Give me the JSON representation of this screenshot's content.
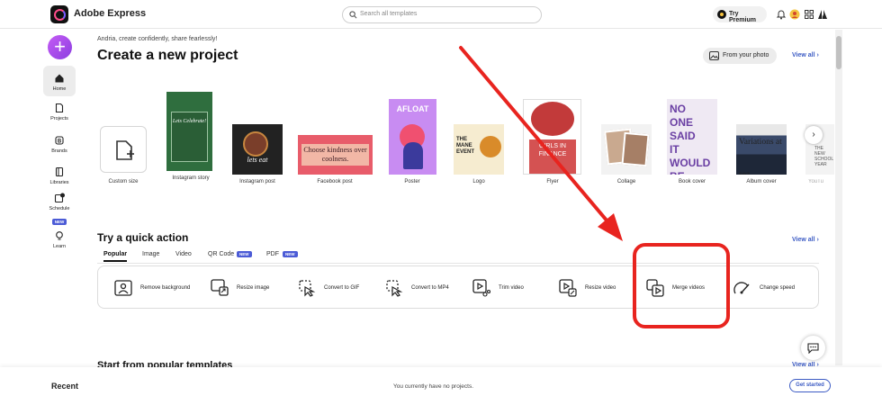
{
  "app": {
    "title": "Adobe Express"
  },
  "search": {
    "placeholder": "Search all templates"
  },
  "header": {
    "premium_label": "Try Premium"
  },
  "sidebar": {
    "create_label": "+",
    "items": [
      {
        "label": "Home"
      },
      {
        "label": "Projects"
      },
      {
        "label": "Brands"
      },
      {
        "label": "Libraries"
      },
      {
        "label": "Schedule",
        "badge": "NEW"
      },
      {
        "label": "Learn"
      }
    ]
  },
  "main": {
    "greeting": "Andria, create confidently, share fearlessly!",
    "heading": "Create a new project",
    "from_photo": "From your photo",
    "view_all": "View all ›"
  },
  "templates": [
    {
      "label": "Custom size"
    },
    {
      "label": "Instagram story",
      "text": "Lets Celebrate!"
    },
    {
      "label": "Instagram post",
      "text": "lets eat"
    },
    {
      "label": "Facebook post",
      "text": "Choose kindness over coolness."
    },
    {
      "label": "Poster",
      "text": "AFLOAT"
    },
    {
      "label": "Logo",
      "text": "THE MANE EVENT"
    },
    {
      "label": "Flyer",
      "text": "GIRLS IN FINANCE"
    },
    {
      "label": "Collage"
    },
    {
      "label": "Book cover",
      "text": "NO ONE SAID IT WOULD BE EASY"
    },
    {
      "label": "Album cover",
      "text": "Variations at sea"
    },
    {
      "label": "YouTu",
      "text": "THE NEW SCHOOL YEAR"
    }
  ],
  "quick_actions": {
    "heading": "Try a quick action",
    "view_all": "View all ›",
    "tabs": [
      {
        "label": "Popular",
        "active": true
      },
      {
        "label": "Image"
      },
      {
        "label": "Video"
      },
      {
        "label": "QR Code",
        "badge": "NEW"
      },
      {
        "label": "PDF",
        "badge": "NEW"
      }
    ],
    "actions": [
      {
        "label": "Remove background",
        "icon": "remove-background-icon"
      },
      {
        "label": "Resize image",
        "icon": "resize-image-icon"
      },
      {
        "label": "Convert to GIF",
        "icon": "convert-gif-icon"
      },
      {
        "label": "Convert to MP4",
        "icon": "convert-mp4-icon"
      },
      {
        "label": "Trim video",
        "icon": "trim-video-icon"
      },
      {
        "label": "Resize video",
        "icon": "resize-video-icon"
      },
      {
        "label": "Merge videos",
        "icon": "merge-videos-icon"
      },
      {
        "label": "Change speed",
        "icon": "change-speed-icon"
      }
    ]
  },
  "popular": {
    "heading": "Start from popular templates",
    "view_all": "View all ›"
  },
  "recent": {
    "title": "Recent",
    "empty_message": "You currently have no projects.",
    "get_started": "Get started"
  },
  "colors": {
    "accent": "#3c5bc4",
    "annotation": "#e8241f",
    "create_button": "#b04ff0"
  }
}
